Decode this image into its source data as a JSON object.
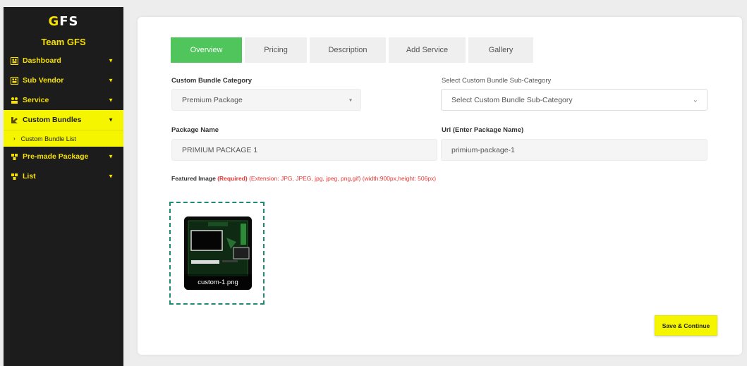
{
  "brand": {
    "logo": "GFS",
    "team_name": "Team GFS"
  },
  "sidebar": {
    "items": [
      {
        "label": "Dashboard",
        "icon": "grid-icon"
      },
      {
        "label": "Sub Vendor",
        "icon": "grid-icon"
      },
      {
        "label": "Service",
        "icon": "service-icon"
      },
      {
        "label": "Custom Bundles",
        "icon": "bundle-icon",
        "active": true
      },
      {
        "label": "Pre-made Package",
        "icon": "package-icon"
      },
      {
        "label": "List",
        "icon": "list-icon"
      }
    ],
    "subitem": {
      "label": "Custom Bundle List"
    }
  },
  "tabs": [
    {
      "label": "Overview",
      "active": true
    },
    {
      "label": "Pricing"
    },
    {
      "label": "Description"
    },
    {
      "label": "Add Service"
    },
    {
      "label": "Gallery"
    }
  ],
  "form": {
    "category_label": "Custom Bundle Category",
    "category_value": "Premium Package",
    "subcategory_label": "Select Custom Bundle Sub-Category",
    "subcategory_value": "Select Custom Bundle Sub-Category",
    "package_name_label": "Package Name",
    "package_name_value": "PRIMIUM PACKAGE 1",
    "url_label": "Url (Enter Package Name)",
    "url_value": "primium-package-1",
    "featured_label": "Featured Image",
    "featured_required": "(Required)",
    "featured_ext": "(Extension: JPG, JPEG, jpg, jpeg, png,gif) (width:900px,height: 506px)",
    "file_name": "custom-1.png"
  },
  "actions": {
    "save_continue": "Save & Continue"
  },
  "colors": {
    "accent_yellow": "#f5f500",
    "active_tab": "#4fc55b",
    "sidebar_bg": "#1c1c1c",
    "required_red": "#e53935",
    "dropzone_border": "#1e8c72"
  }
}
